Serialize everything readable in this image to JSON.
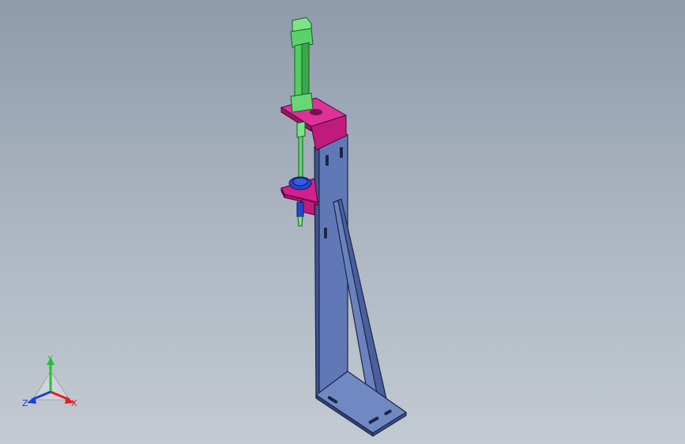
{
  "view": {
    "colors": {
      "background_top": "#8e9bab",
      "background_bottom": "#c3cad2",
      "bracket_blue": "#5a73b0",
      "bracket_edge": "#1c2545",
      "mount_magenta": "#d61e8c",
      "cylinder_green": "#4fd15f",
      "piston_blue": "#2846c8"
    }
  },
  "model": {
    "parts": [
      {
        "name": "support-bracket",
        "color": "bracket_blue"
      },
      {
        "name": "upper-mount-plate",
        "color": "mount_magenta"
      },
      {
        "name": "lower-mount-plate",
        "color": "mount_magenta"
      },
      {
        "name": "air-cylinder",
        "color": "cylinder_green"
      },
      {
        "name": "piston-flange",
        "color": "piston_blue"
      }
    ]
  },
  "triad": {
    "x_label": "X",
    "y_label": "Y",
    "z_label": "Z",
    "x_color": "#e02020",
    "y_color": "#22c03a",
    "z_color": "#1a3fd8"
  }
}
